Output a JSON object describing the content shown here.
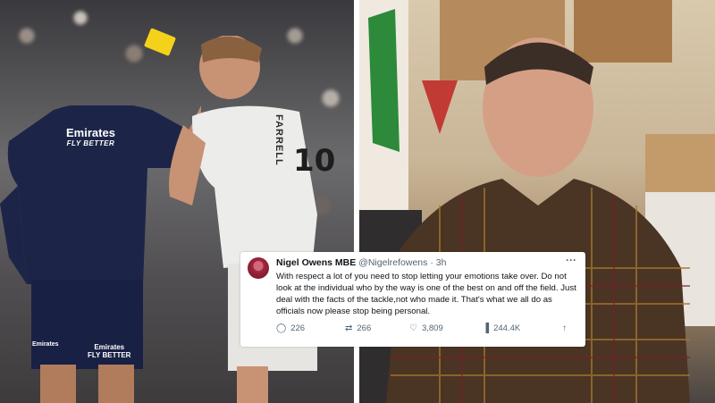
{
  "left_photo": {
    "referee_sponsor": "Emirates",
    "referee_sponsor_tagline": "FLY BETTER",
    "shorts_sponsor": "Emirates",
    "shorts_sponsor_tagline": "FLY BETTER",
    "jersey_name": "FARRELL",
    "jersey_number": "10"
  },
  "tweet": {
    "display_name": "Nigel Owens MBE",
    "handle": "@Nigelrefowens",
    "time": "· 3h",
    "more": "···",
    "body": "With respect a lot of you need to stop letting your emotions take over. Do not look at the individual who by the way is one of the best on and off the field. Just deal with the facts of the tackle,not who made it. That's what we all do as officials now please stop being personal.",
    "stats": {
      "replies": "226",
      "retweets": "266",
      "likes": "3,809",
      "views": "244.4K"
    },
    "icons": [
      "reply-icon",
      "retweet-icon",
      "like-icon",
      "views-icon",
      "share-icon"
    ]
  },
  "colors": {
    "yellow_card": "#f4d21a",
    "referee_kit": "#1c2548",
    "tweet_text": "#0f1419",
    "tweet_muted": "#536471"
  }
}
